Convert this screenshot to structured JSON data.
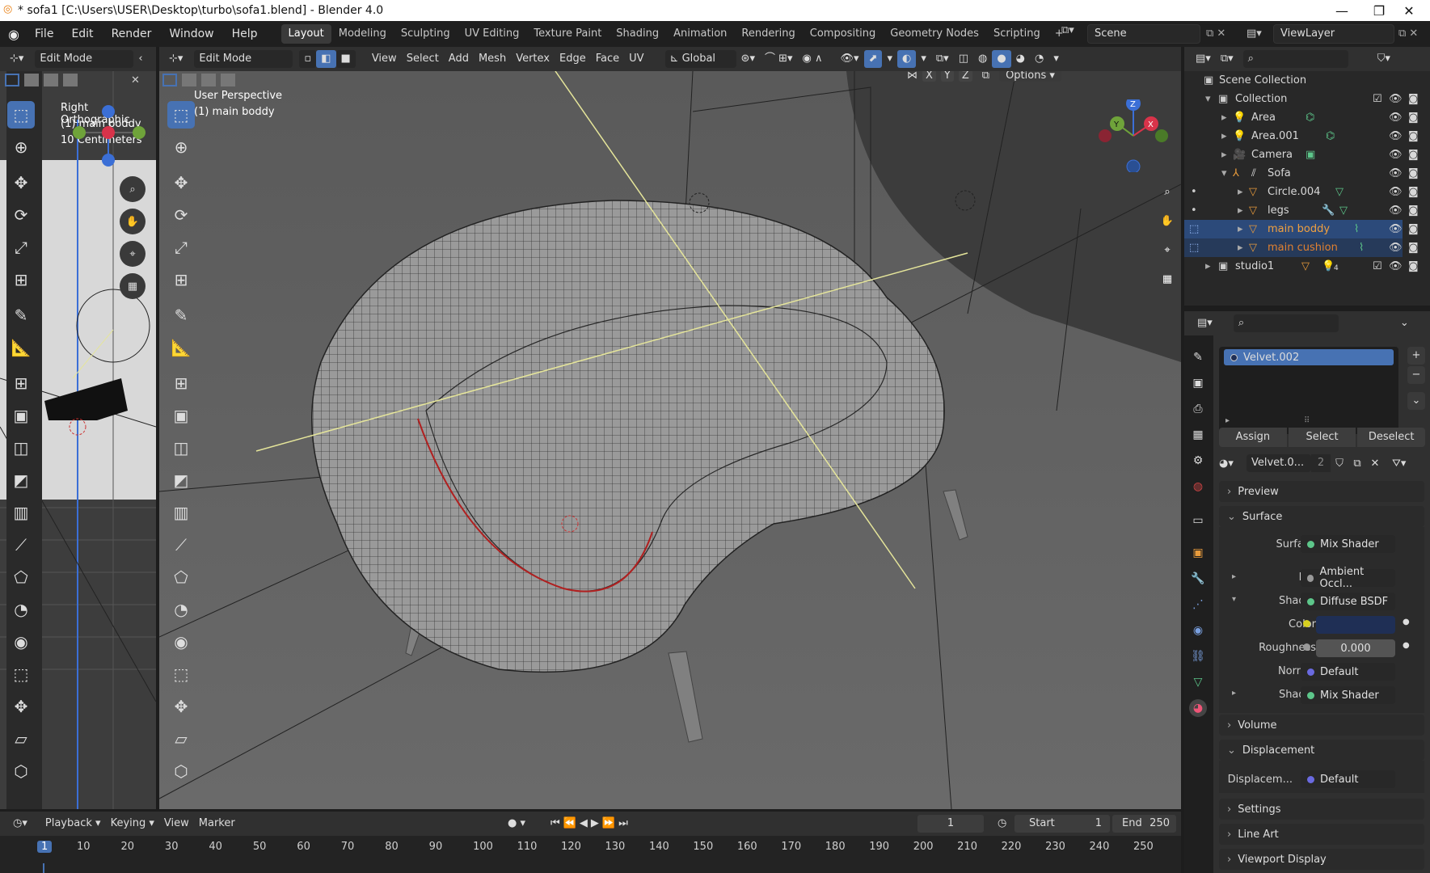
{
  "window": {
    "title": "* sofa1 [C:\\Users\\USER\\Desktop\\turbo\\sofa1.blend] - Blender 4.0",
    "minimize": "—",
    "maximize": "❐",
    "close": "✕"
  },
  "menu": [
    "File",
    "Edit",
    "Render",
    "Window",
    "Help"
  ],
  "workspaces": [
    "Layout",
    "Modeling",
    "Sculpting",
    "UV Editing",
    "Texture Paint",
    "Shading",
    "Animation",
    "Rendering",
    "Compositing",
    "Geometry Nodes",
    "Scripting",
    "+"
  ],
  "scene": "Scene",
  "view_layer": "ViewLayer",
  "left_view": {
    "mode": "Edit Mode",
    "overlay_line1": "Right Orthographic",
    "overlay_line2": "(1) main boddy",
    "overlay_line3": "10 Centimeters"
  },
  "main_view": {
    "mode": "Edit Mode",
    "menus": [
      "View",
      "Select",
      "Add",
      "Mesh",
      "Vertex",
      "Edge",
      "Face",
      "UV"
    ],
    "orientation": "Global",
    "overlay_line1": "User Perspective",
    "overlay_line2": "(1) main boddy",
    "axes": [
      "X",
      "Y",
      "Z"
    ],
    "options": "Options"
  },
  "gizmo": {
    "z": "Z",
    "y": "Y",
    "x": "X"
  },
  "outliner": {
    "root": "Scene Collection",
    "rows": [
      "Collection",
      "Area",
      "Area.001",
      "Camera",
      "Sofa",
      "Circle.004",
      "legs",
      "main boddy",
      "main cushion",
      "studio1"
    ],
    "studio_count": "4"
  },
  "properties": {
    "material_slot": "Velvet.002",
    "assign": "Assign",
    "select": "Select",
    "deselect": "Deselect",
    "material_name": "Velvet.0...",
    "users": "2",
    "preview": "Preview",
    "surface_section": "Surface",
    "surface_label": "Surface",
    "surface_value": "Mix Shader",
    "fac_label": "Fac",
    "fac_value": "Ambient Occl...",
    "shader1_label": "Shader",
    "shader1_value": "Diffuse BSDF",
    "color_label": "Color",
    "color_hex": "#1f2f55",
    "roughness_label": "Roughness",
    "roughness_value": "0.000",
    "normal_label": "Normal",
    "normal_value": "Default",
    "shader2_label": "Shader",
    "shader2_value": "Mix Shader",
    "volume": "Volume",
    "displacement_section": "Displacement",
    "displacement_label": "Displacem...",
    "displacement_value": "Default",
    "settings": "Settings",
    "line_art": "Line Art",
    "viewport_display": "Viewport Display"
  },
  "timeline": {
    "playback": "Playback",
    "keying": "Keying",
    "view": "View",
    "marker": "Marker",
    "current_frame": "1",
    "start_label": "Start",
    "start": "1",
    "end_label": "End",
    "end": "250",
    "ticks": [
      "1",
      "10",
      "20",
      "30",
      "40",
      "50",
      "60",
      "70",
      "80",
      "90",
      "100",
      "110",
      "120",
      "130",
      "140",
      "150",
      "160",
      "170",
      "180",
      "190",
      "200",
      "210",
      "220",
      "230",
      "240",
      "250"
    ]
  }
}
